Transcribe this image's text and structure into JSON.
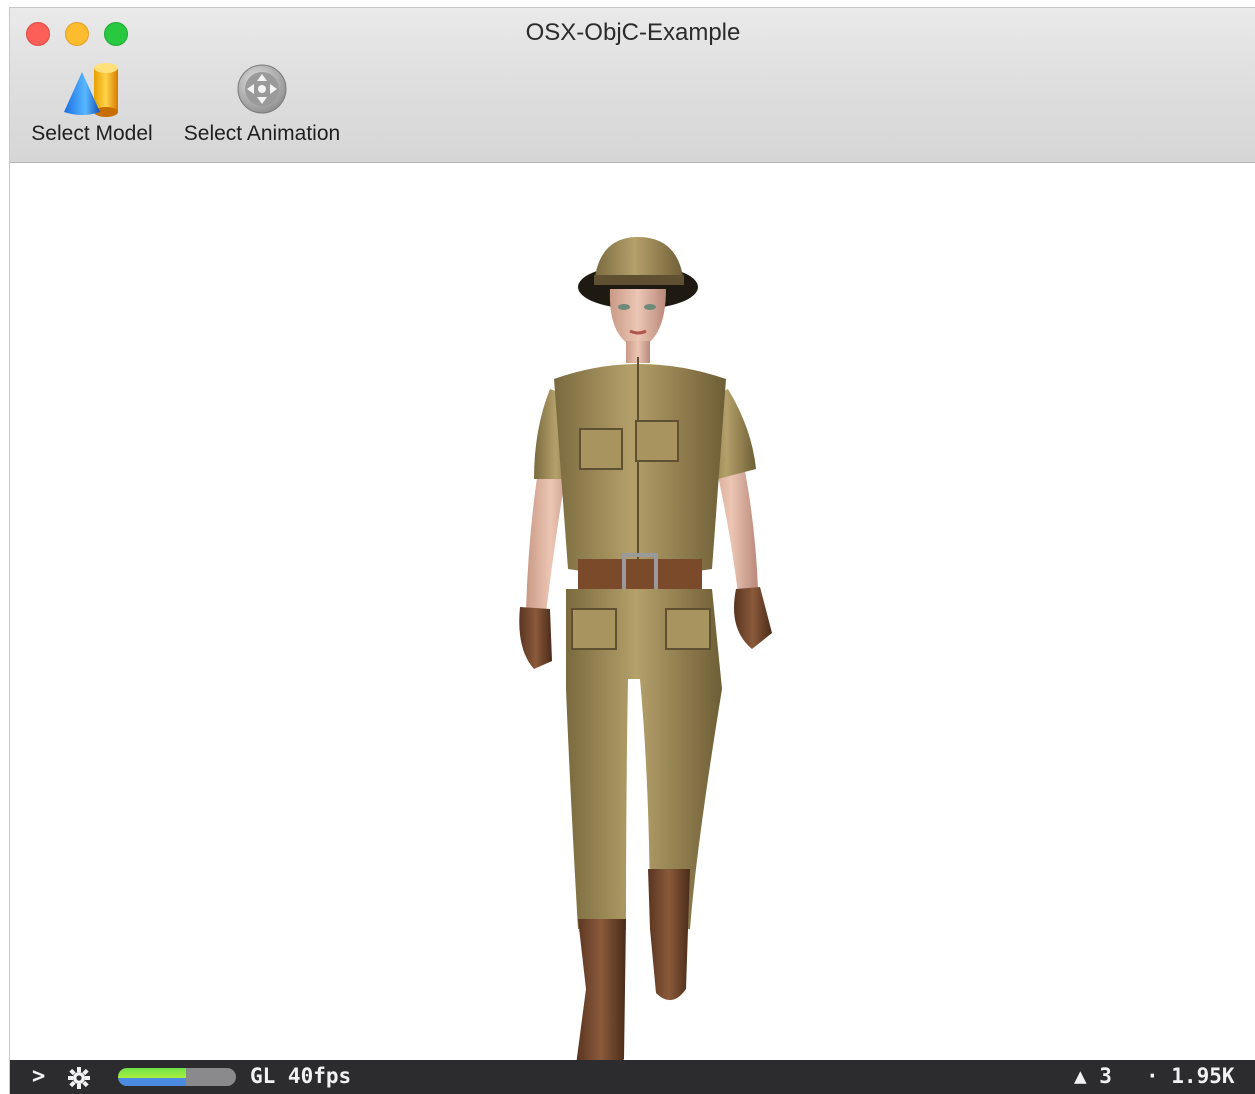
{
  "window": {
    "title": "OSX-ObjC-Example"
  },
  "toolbar": {
    "items": [
      {
        "label": "Select Model",
        "icon": "model-shapes-icon"
      },
      {
        "label": "Select Animation",
        "icon": "animation-joystick-icon"
      }
    ]
  },
  "viewport": {
    "scene": "3d-character-explorer-walking"
  },
  "statusbar": {
    "chevron": ">",
    "gear_icon": "gear-icon",
    "progress": 0.58,
    "fps_text": "GL 40fps",
    "triangles_text": "▲ 3",
    "points_text": "· 1.95K"
  },
  "colors": {
    "close": "#fc5f57",
    "minimize": "#fdbc2e",
    "zoom": "#28c840",
    "statusbar_bg": "#2c2c2e",
    "progress_green": "#8ee83f",
    "progress_blue": "#4a8ae0"
  }
}
